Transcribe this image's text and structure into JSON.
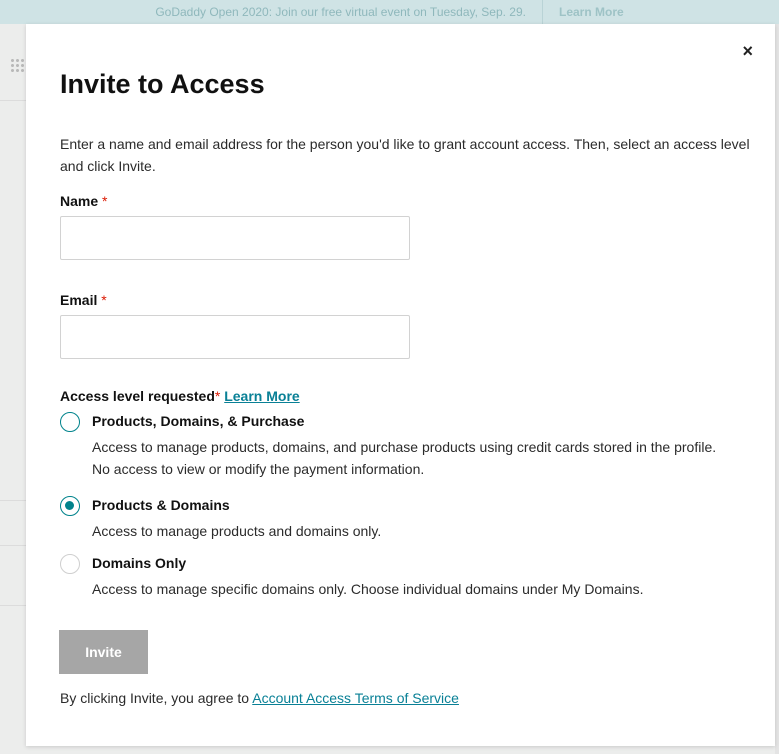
{
  "background": {
    "banner_text": "GoDaddy Open 2020: Join our free virtual event on Tuesday, Sep. 29.",
    "banner_link": "Learn More"
  },
  "modal": {
    "close_icon": "close-icon",
    "close_glyph": "×",
    "title": "Invite to Access",
    "intro": "Enter a name and email address for the person you'd like to grant account access. Then, select an access level and click Invite.",
    "name_label": "Name",
    "email_label": "Email",
    "required_mark": "*",
    "name_value": "",
    "email_value": "",
    "access_label": "Access level requested",
    "learn_more": "Learn More",
    "options": [
      {
        "title": "Products, Domains, & Purchase",
        "desc": "Access to manage products, domains, and purchase products using credit cards stored in the profile. No access to view or modify the payment information.",
        "selected": false
      },
      {
        "title": "Products & Domains",
        "desc": "Access to manage products and domains only.",
        "selected": true
      },
      {
        "title": "Domains Only",
        "desc": "Access to manage specific domains only. Choose individual domains under My Domains.",
        "selected": false
      }
    ],
    "invite_button": "Invite",
    "terms_prefix": "By clicking Invite, you agree to",
    "terms_link": "Account Access Terms of Service"
  },
  "colors": {
    "accent": "#00838c",
    "link": "#098096",
    "required": "#db1802",
    "button_disabled": "#a6a6a6"
  }
}
